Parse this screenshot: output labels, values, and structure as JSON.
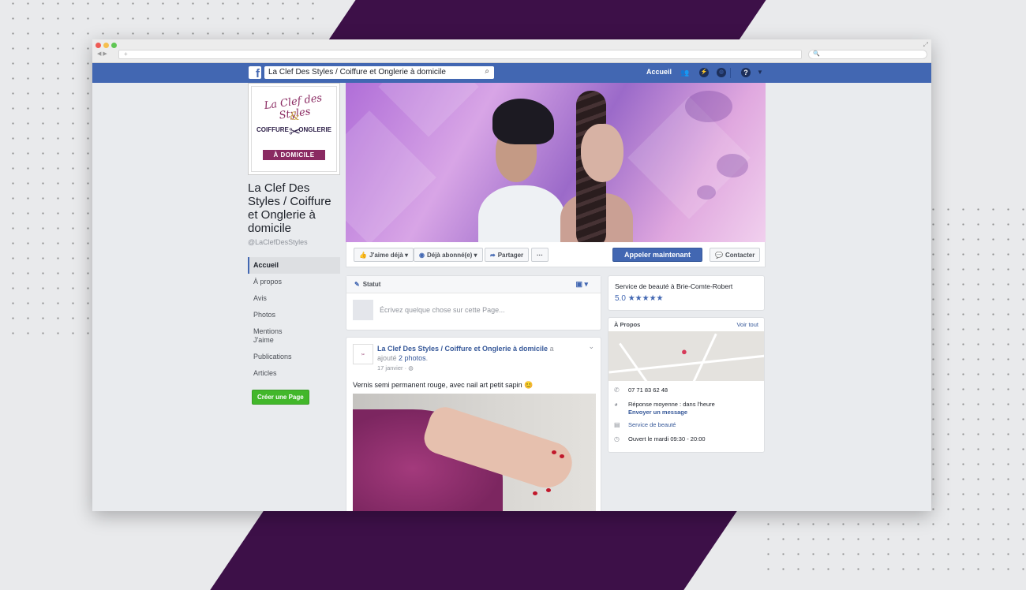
{
  "browser": {
    "url_placeholder": "+",
    "search_placeholder": "🔍"
  },
  "fb": {
    "logo": "f",
    "search_value": "La Clef Des Styles / Coiffure et Onglerie à domicile",
    "nav_home": "Accueil"
  },
  "logo": {
    "title": "La Clef des Styles",
    "amp": "&",
    "left_word": "COIFFURE",
    "right_word": "ONGLERIE",
    "banner": "À DOMICILE"
  },
  "page": {
    "name": "La Clef Des Styles / Coiffure et Onglerie à domicile",
    "handle": "@LaClefDesStyles"
  },
  "sidebar": {
    "items": [
      {
        "label": "Accueil"
      },
      {
        "label": "À propos"
      },
      {
        "label": "Avis"
      },
      {
        "label": "Photos"
      },
      {
        "label": "Mentions J'aime"
      },
      {
        "label": "Publications"
      },
      {
        "label": "Articles"
      }
    ],
    "create_page": "Créer une Page"
  },
  "actions": {
    "like": "J'aime déjà",
    "follow": "Déjà abonné(e)",
    "share": "Partager",
    "more": "···",
    "call": "Appeler maintenant",
    "contact": "Contacter"
  },
  "status": {
    "header": "Statut",
    "placeholder": "Écrivez quelque chose sur cette Page..."
  },
  "post": {
    "author": "La Clef Des Styles / Coiffure et Onglerie à domicile",
    "action_a": "a",
    "action_b": "ajouté",
    "photos_link": "2 photos",
    "date": "17 janvier",
    "text": "Vernis semi permanent rouge, avec nail art petit sapin 😊"
  },
  "service": {
    "title": "Service de beauté à Brie-Comte-Robert",
    "rating": "5.0",
    "stars": "★★★★★"
  },
  "about": {
    "header": "À Propos",
    "see_all": "Voir tout",
    "phone": "07 71 83 62 48",
    "response": "Réponse moyenne : dans l'heure",
    "send_message": "Envoyer un message",
    "category": "Service de beauté",
    "hours": "Ouvert le mardi 09:30 - 20:00"
  },
  "colors": {
    "fb_blue": "#4267b2",
    "bg_band": "#3d1048",
    "brand_plum": "#8a2a62"
  }
}
